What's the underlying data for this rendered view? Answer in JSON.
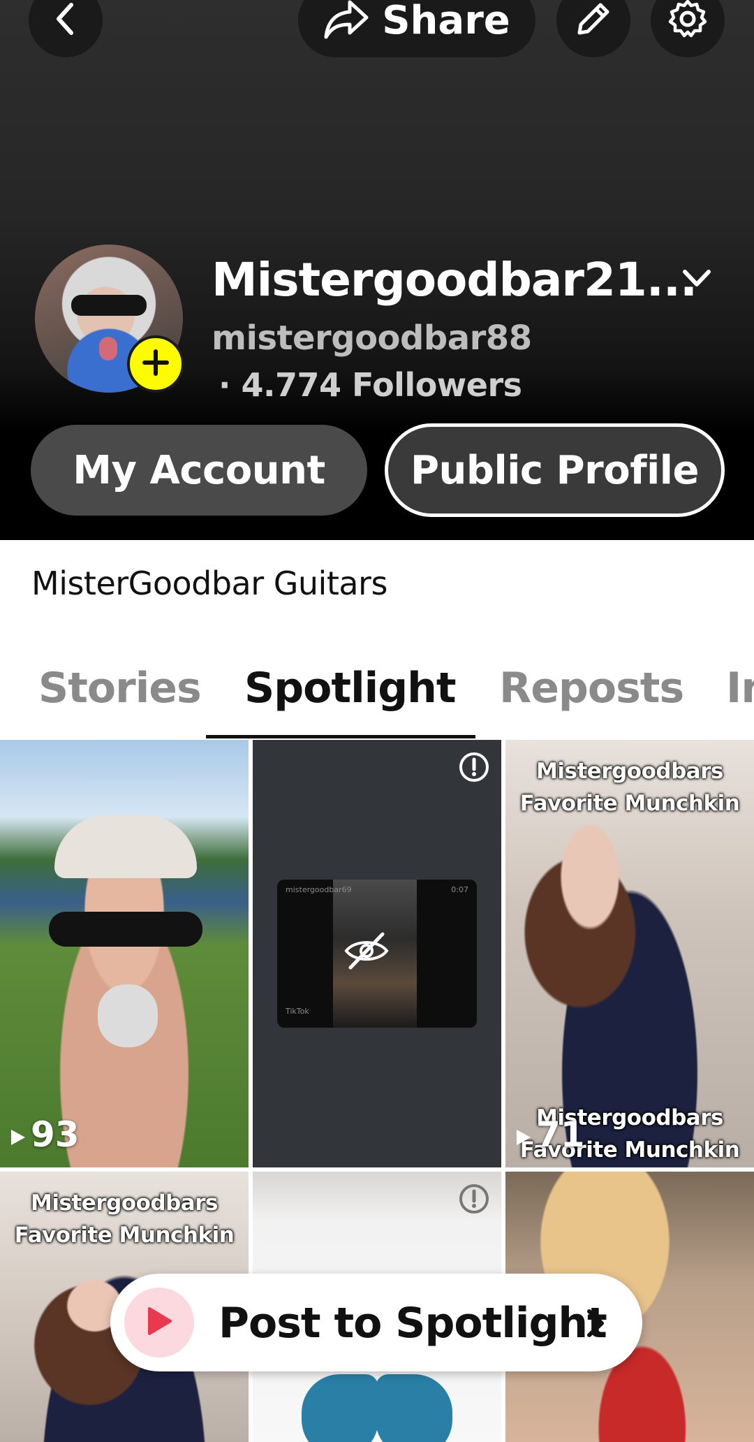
{
  "header": {
    "back_icon": "chevron-left-icon",
    "share_label": "Share",
    "edit_icon": "pencil-icon",
    "settings_icon": "gear-icon"
  },
  "profile": {
    "display_name": "Mistergoodbar21...",
    "username": "mistergoodbar88",
    "followers": "· 4.774 Followers",
    "add_badge_color": "#fffc00"
  },
  "buttons": {
    "my_account": "My Account",
    "public_profile": "Public Profile"
  },
  "bio": "MisterGoodbar Guitars",
  "tabs": [
    {
      "label": "Stories"
    },
    {
      "label": "Spotlight",
      "active": true
    },
    {
      "label": "Reposts"
    },
    {
      "label": "In"
    }
  ],
  "grid": {
    "tiles": [
      {
        "play_count": "93"
      },
      {
        "status_icon": "alert-icon",
        "overlay_icon": "eye-off-icon",
        "inner_top_left": "mistergoodbar69",
        "inner_top_right": "0:07",
        "inner_bottom": "TikTok"
      },
      {
        "caption_top_1": "Mistergoodbars",
        "caption_top_2": "Favorite Munchkin",
        "caption_bottom_1": "Mistergoodbars",
        "caption_bottom_2": "Favorite Munchkin",
        "play_count": "71"
      },
      {
        "caption_top_1": "Mistergoodbars",
        "caption_top_2": "Favorite Munchkin"
      },
      {
        "status_icon": "alert-icon"
      },
      {}
    ]
  },
  "cta": {
    "label": "Post to Spotlight",
    "accent": "#e8394f"
  }
}
